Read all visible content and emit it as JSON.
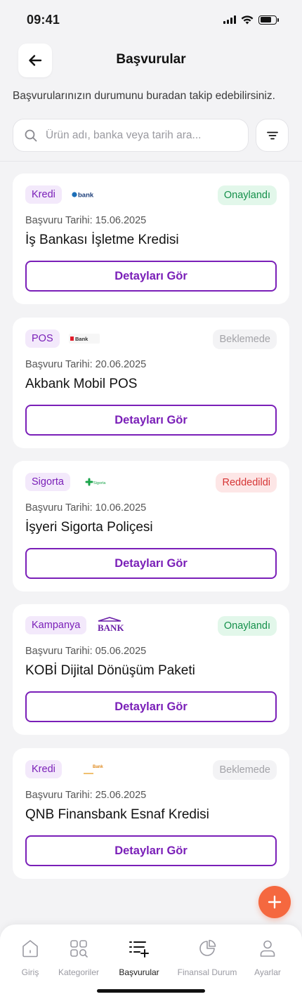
{
  "status_bar": {
    "time": "09:41"
  },
  "header": {
    "title": "Başvurular"
  },
  "subtitle": "Başvurularınızın durumunu buradan takip edebilirsiniz.",
  "search": {
    "placeholder": "Ürün adı, banka veya tarih ara...",
    "value": ""
  },
  "colors": {
    "brand_purple": "#7a1fb8",
    "approved": "#14904a",
    "pending": "#a3a3a8",
    "rejected": "#d63535",
    "fab": "#f5683f"
  },
  "applications": [
    {
      "category": "Kredi",
      "bank_logo_text": "bank",
      "status": "Onaylandı",
      "date": "Başvuru Tarihi: 15.06.2025",
      "title": "İş Bankası İşletme Kredisi",
      "button": "Detayları Gör"
    },
    {
      "category": "POS",
      "bank_logo_text": "Bank",
      "status": "Beklemede",
      "date": "Başvuru Tarihi: 20.06.2025",
      "title": "Akbank Mobil POS",
      "button": "Detayları Gör"
    },
    {
      "category": "Sigorta",
      "bank_logo_text": "Sigorta",
      "status": "Reddedildi",
      "date": "Başvuru Tarihi: 10.06.2025",
      "title": "İşyeri Sigorta Poliçesi",
      "button": "Detayları Gör"
    },
    {
      "category": "Kampanya",
      "bank_logo_text": "BANK",
      "status": "Onaylandı",
      "date": "Başvuru Tarihi: 05.06.2025",
      "title": "KOBİ Dijital Dönüşüm Paketi",
      "button": "Detayları Gör"
    },
    {
      "category": "Kredi",
      "bank_logo_text": "Bank",
      "status": "Beklemede",
      "date": "Başvuru Tarihi: 25.06.2025",
      "title": "QNB Finansbank Esnaf Kredisi",
      "button": "Detayları Gör"
    }
  ],
  "nav": {
    "items": [
      {
        "label": "Giriş",
        "icon": "home-icon"
      },
      {
        "label": "Kategoriler",
        "icon": "categories-icon"
      },
      {
        "label": "Başvurular",
        "icon": "applications-icon",
        "active": true
      },
      {
        "label": "Finansal Durum",
        "icon": "pie-chart-icon"
      },
      {
        "label": "Ayarlar",
        "icon": "user-icon"
      }
    ]
  }
}
